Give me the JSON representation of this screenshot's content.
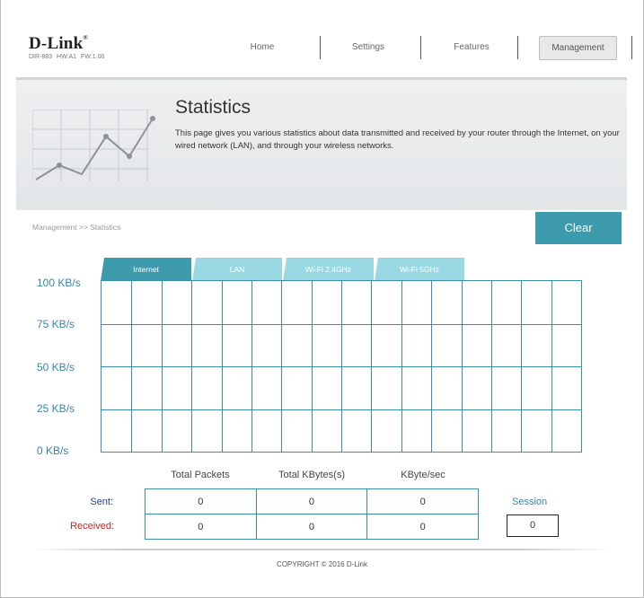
{
  "brand": {
    "logo": "D-Link",
    "tm": "®",
    "model": "DIR-883",
    "hw": "HW:A1",
    "fw": "FW:1.00"
  },
  "nav": {
    "home": "Home",
    "settings": "Settings",
    "features": "Features",
    "management": "Management"
  },
  "banner": {
    "title": "Statistics",
    "description": "This page gives you various statistics about data transmitted and received by your router through the Internet, on your wired network (LAN), and through your wireless networks."
  },
  "breadcrumb": "Management >> Statistics",
  "clear_label": "Clear",
  "tabs": [
    "Internet",
    "LAN",
    "Wi-Fi 2.4GHz",
    "Wi-Fi 5GHz"
  ],
  "active_tab": "Internet",
  "graph": {
    "y_labels": [
      "100 KB/s",
      "75 KB/s",
      "50 KB/s",
      "25 KB/s",
      "0 KB/s"
    ]
  },
  "stats": {
    "headers": [
      "Total Packets",
      "Total KBytes(s)",
      "KByte/sec"
    ],
    "sent_label": "Sent:",
    "received_label": "Received:",
    "sent": [
      "0",
      "0",
      "0"
    ],
    "received": [
      "0",
      "0",
      "0"
    ],
    "session_label": "Session",
    "session_value": "0"
  },
  "colors": {
    "accent": "#3e9aad",
    "tab_inactive": "#9ad9e4",
    "sent": "#2b3f8c",
    "received": "#d42020"
  },
  "copyright": "COPYRIGHT © 2016 D-Link"
}
